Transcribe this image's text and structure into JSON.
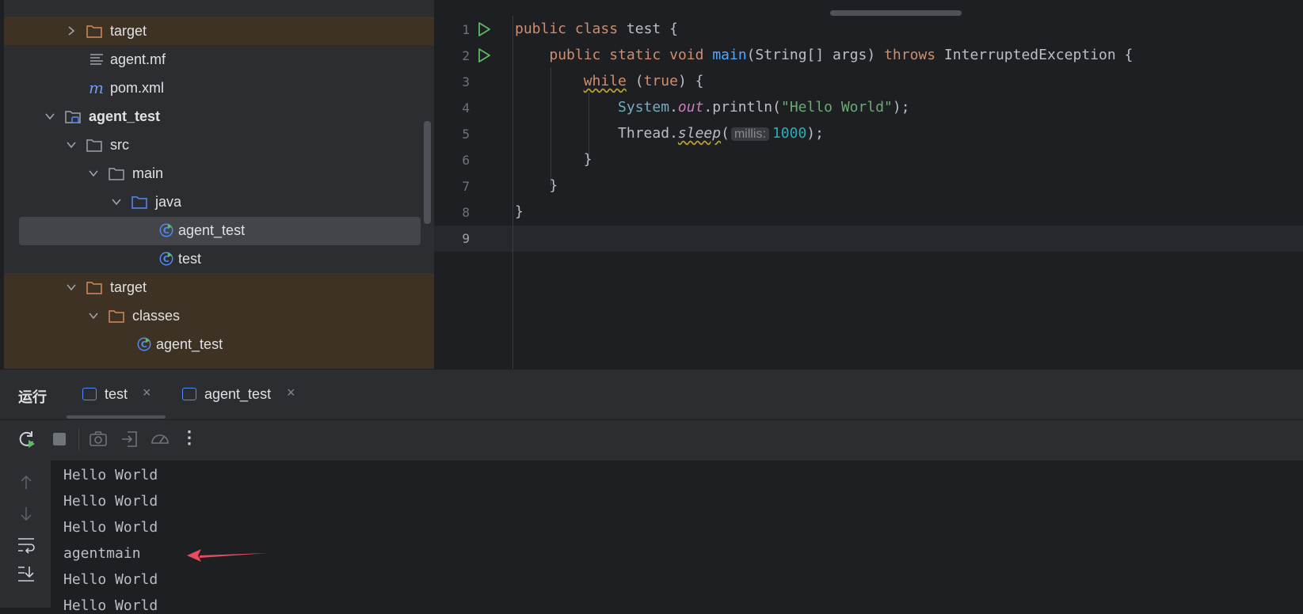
{
  "project_tree": {
    "rows": [
      {
        "label": "target",
        "kind": "folder-excluded",
        "expanded": false
      },
      {
        "label": "agent.mf",
        "kind": "text-file"
      },
      {
        "label": "pom.xml",
        "kind": "maven-file"
      },
      {
        "label": "agent_test",
        "kind": "module-folder",
        "expanded": true
      },
      {
        "label": "src",
        "kind": "folder",
        "expanded": true
      },
      {
        "label": "main",
        "kind": "folder",
        "expanded": true
      },
      {
        "label": "java",
        "kind": "source-folder",
        "expanded": true
      },
      {
        "label": "agent_test",
        "kind": "java-class",
        "selected": true
      },
      {
        "label": "test",
        "kind": "java-class"
      },
      {
        "label": "target",
        "kind": "folder-excluded",
        "expanded": true
      },
      {
        "label": "classes",
        "kind": "folder-excluded",
        "expanded": true
      },
      {
        "label": "agent_test",
        "kind": "java-class"
      }
    ]
  },
  "editor": {
    "line_numbers": [
      "1",
      "2",
      "3",
      "4",
      "5",
      "6",
      "7",
      "8",
      "9"
    ],
    "lines": {
      "l1": {
        "kw1": "public",
        "kw2": "class",
        "rest": " test {"
      },
      "l2": {
        "kw1": "public",
        "kw2": "static",
        "kw3": "void",
        "fn": "main",
        "params": "(String[] args) ",
        "kw4": "throws",
        "rest": " InterruptedException {"
      },
      "l3": {
        "kw": "while",
        "paren_open": " (",
        "kw2": "true",
        "rest": ") {"
      },
      "l4": {
        "cls": "System",
        "dot": ".",
        "field": "out",
        "call": ".println(",
        "str": "\"Hello World\"",
        "end": ");"
      },
      "l5": {
        "cls": "Thread.",
        "method": "sleep",
        "open": "(",
        "hint": "millis:",
        "num": "1000",
        "end": ");"
      },
      "l6": "}",
      "l7": "}",
      "l8": "}"
    }
  },
  "run_panel": {
    "title": "运行",
    "tabs": [
      {
        "label": "test",
        "close": "×"
      },
      {
        "label": "agent_test",
        "close": "×"
      }
    ],
    "toolbar_icons": [
      "rerun-icon",
      "stop-icon",
      "screenshot-icon",
      "login-icon",
      "profiler-icon",
      "more-icon"
    ],
    "more_label": "⋮",
    "side_icons": [
      "up-arrow-icon",
      "down-arrow-icon",
      "soft-wrap-icon",
      "scroll-to-end-icon"
    ],
    "console_lines": [
      "Hello World",
      "Hello World",
      "Hello World",
      "agentmain",
      "Hello World",
      "Hello World"
    ]
  },
  "colors": {
    "annotation_arrow": "#e84b5f",
    "folder_excluded": "#d48a5a",
    "folder": "#9fa2a8",
    "source_folder": "#548af7",
    "run_green": "#5fb865"
  }
}
